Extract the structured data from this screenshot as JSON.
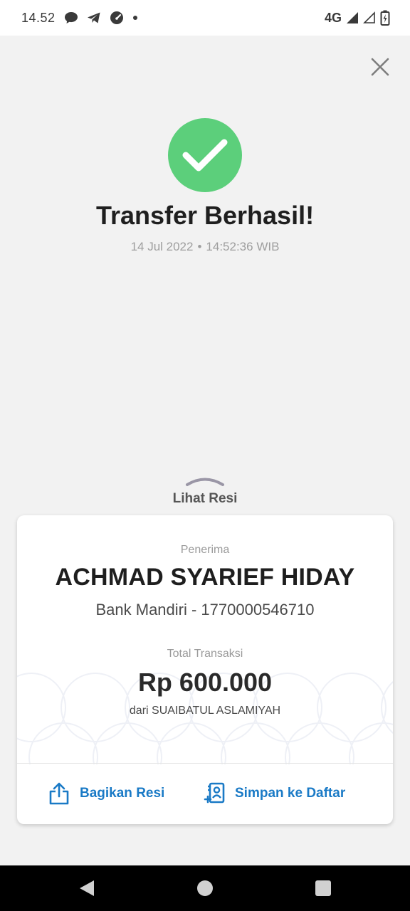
{
  "status_bar": {
    "time": "14.52",
    "network": "4G",
    "icons": [
      "chat-bubble-icon",
      "telegram-icon",
      "speedometer-icon",
      "dot-icon",
      "signal-icon",
      "signal-empty-icon",
      "battery-charging-icon"
    ]
  },
  "header": {
    "close_icon": "close-icon"
  },
  "result": {
    "icon": "checkmark-circle-icon",
    "title": "Transfer Berhasil!",
    "date": "14 Jul 2022",
    "separator": "•",
    "time": "14:52:36 WIB"
  },
  "receipt_toggle": {
    "icon": "chevron-up-icon",
    "label": "Lihat Resi"
  },
  "card": {
    "recipient_label": "Penerima",
    "recipient_name": "ACHMAD SYARIEF HIDAY",
    "recipient_bank": "Bank Mandiri - 1770000546710",
    "total_label": "Total Transaksi",
    "amount": "Rp 600.000",
    "sender": "dari SUAIBATUL ASLAMIYAH",
    "actions": [
      {
        "label": "Bagikan Resi",
        "icon": "share-icon"
      },
      {
        "label": "Simpan ke Daftar",
        "icon": "add-contact-icon"
      }
    ]
  },
  "colors": {
    "success": "#5ccf7b",
    "accent": "#1a7ac6",
    "background": "#f2f2f2"
  },
  "nav_bar": {
    "icons": [
      "back-icon",
      "home-icon",
      "recents-icon"
    ]
  }
}
